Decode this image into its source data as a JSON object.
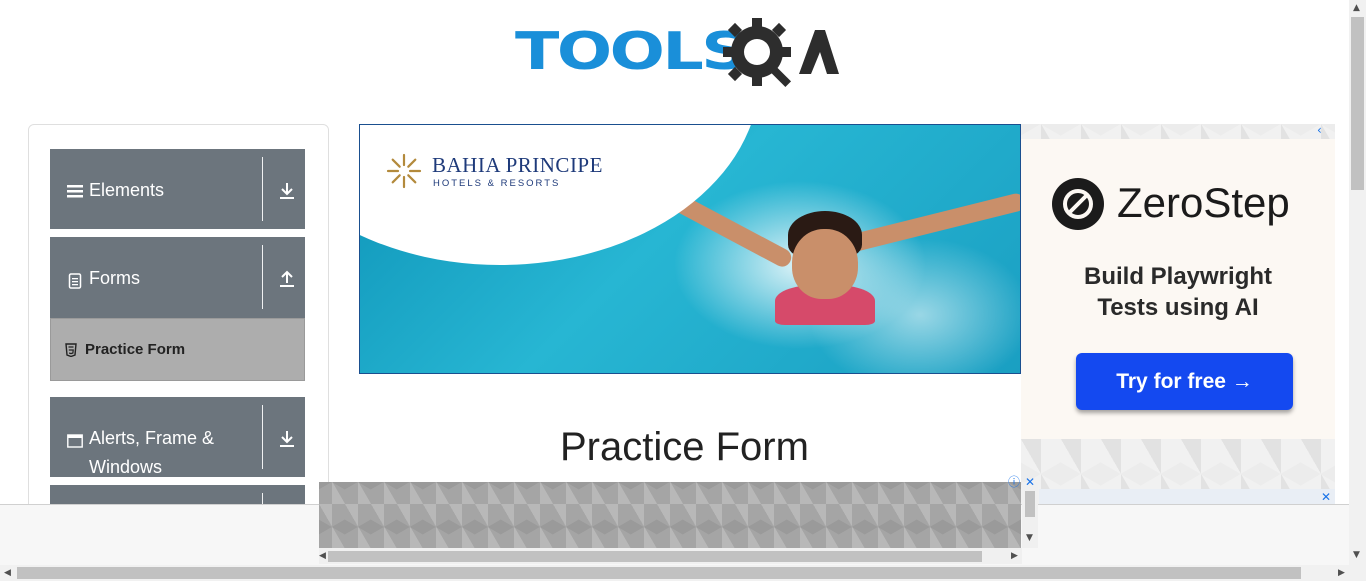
{
  "header": {
    "logo_text": "TOOLS"
  },
  "sidebar": {
    "groups": [
      {
        "label": "Elements",
        "icon": "hamburger-icon",
        "toggle": "download-arrow-icon"
      },
      {
        "label": "Forms",
        "icon": "document-icon",
        "toggle": "upload-arrow-icon"
      },
      {
        "label": "Alerts, Frame & Windows",
        "icon": "window-icon",
        "toggle": "download-arrow-icon"
      }
    ],
    "active_item": {
      "label": "Practice Form",
      "icon": "html5-icon"
    }
  },
  "banner_ad": {
    "brand": "BAHIA PRINCIPE",
    "subtitle": "HOTELS & RESORTS"
  },
  "side_ad": {
    "brand": "ZeroStep",
    "tagline": "Build Playwright Tests using AI",
    "cta": "Try for free →",
    "cta_color": "#1449f0"
  },
  "main": {
    "page_title": "Practice Form"
  },
  "colors": {
    "sidebar_group": "#6c757d",
    "active_item": "#adadad",
    "logo_blue": "#1a8fd9",
    "logo_dark": "#2d2d2d"
  }
}
